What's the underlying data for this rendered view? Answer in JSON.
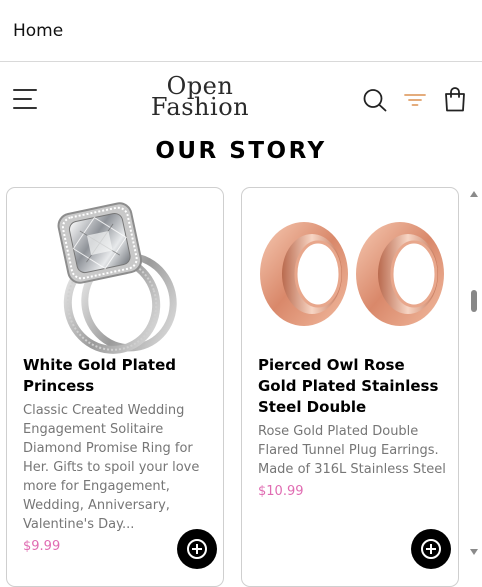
{
  "topbar": {
    "title": "Home"
  },
  "header": {
    "logo_line1": "Open",
    "logo_line2": "Fashion",
    "icons": [
      "menu-icon",
      "search-icon",
      "filter-icon",
      "shopping-bag-icon"
    ],
    "accent_color": "#e0a06a"
  },
  "page": {
    "title": "OUR STORY"
  },
  "products": [
    {
      "name": "White Gold Plated Princess",
      "description": "Classic Created Wedding Engagement Solitaire Diamond Promise Ring for Her. Gifts to spoil your love more for Engagement, Wedding, Anniversary, Valentine's Day...",
      "price": "$9.99",
      "image": "diamond-ring-image"
    },
    {
      "name": "Pierced Owl Rose Gold Plated Stainless Steel Double",
      "description": "Rose Gold Plated Double Flared Tunnel Plug Earrings. Made of 316L Stainless Steel",
      "price": "$10.99",
      "image": "rose-gold-plugs-image"
    }
  ],
  "colors": {
    "price": "#e06cb2",
    "button": "#000000"
  }
}
